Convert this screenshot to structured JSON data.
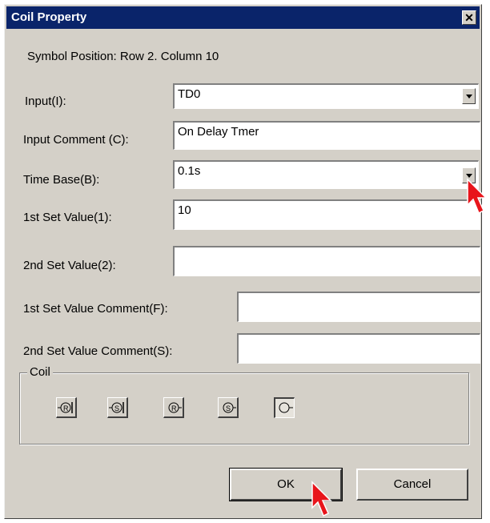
{
  "window": {
    "title": "Coil Property",
    "close_glyph": "✕"
  },
  "symbol_position": "Symbol Position:  Row 2. Column 10",
  "fields": {
    "input": {
      "label": "Input(I):",
      "value": "TD0"
    },
    "input_comment": {
      "label": "Input Comment (C):",
      "value": "On Delay Tmer"
    },
    "time_base": {
      "label": "Time Base(B):",
      "value": "0.1s"
    },
    "set_value_1": {
      "label": "1st Set Value(1):",
      "value": "10"
    },
    "set_value_2": {
      "label": "2nd Set Value(2):",
      "value": ""
    },
    "set_value_1_comment": {
      "label": "1st Set Value Comment(F):",
      "value": ""
    },
    "set_value_2_comment": {
      "label": "2nd Set Value Comment(S):",
      "value": ""
    }
  },
  "coil": {
    "group_label": "Coil",
    "buttons": [
      {
        "name": "reset-edge-coil",
        "glyph": "R"
      },
      {
        "name": "set-edge-coil",
        "glyph": "S"
      },
      {
        "name": "reset-coil",
        "glyph": "R"
      },
      {
        "name": "set-coil",
        "glyph": "S"
      },
      {
        "name": "normal-coil",
        "glyph": "",
        "selected": true
      }
    ]
  },
  "buttons": {
    "ok": "OK",
    "cancel": "Cancel"
  },
  "colors": {
    "titlebar": "#0a246a",
    "face": "#d4d0c8",
    "cursor": "#e8151b"
  }
}
